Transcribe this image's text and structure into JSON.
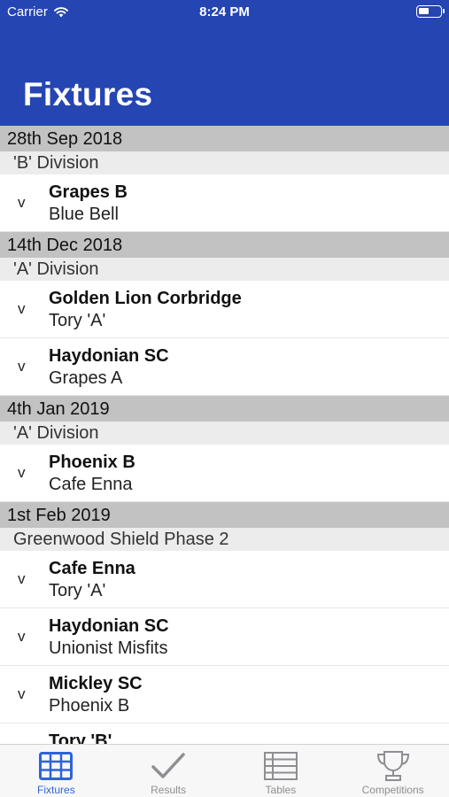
{
  "status": {
    "carrier": "Carrier",
    "time": "8:24 PM",
    "wifi_icon": "wifi-icon",
    "battery_icon": "battery-icon"
  },
  "header": {
    "title": "Fixtures",
    "background": "#2545b2"
  },
  "fixtures": {
    "vs_text": "v",
    "groups": [
      {
        "date": "28th Sep 2018",
        "division": "'B' Division",
        "matches": [
          {
            "home": "Grapes B",
            "away": "Blue Bell"
          }
        ]
      },
      {
        "date": "14th Dec 2018",
        "division": "'A' Division",
        "matches": [
          {
            "home": "Golden Lion Corbridge",
            "away": "Tory 'A'"
          },
          {
            "home": "Haydonian SC",
            "away": "Grapes A"
          }
        ]
      },
      {
        "date": "4th Jan 2019",
        "division": "'A' Division",
        "matches": [
          {
            "home": "Phoenix B",
            "away": "Cafe Enna"
          }
        ]
      },
      {
        "date": "1st Feb 2019",
        "division": "Greenwood Shield Phase 2",
        "matches": [
          {
            "home": "Cafe Enna",
            "away": "Tory 'A'"
          },
          {
            "home": "Haydonian SC",
            "away": "Unionist Misfits"
          },
          {
            "home": "Mickley SC",
            "away": "Phoenix B"
          },
          {
            "home": "Tory 'B'",
            "away": ""
          }
        ]
      }
    ]
  },
  "tabbar": {
    "active_color": "#2f63d8",
    "inactive_color": "#8e8e93",
    "tabs": [
      {
        "label": "Fixtures",
        "icon": "grid-icon",
        "active": true
      },
      {
        "label": "Results",
        "icon": "checkmark-icon",
        "active": false
      },
      {
        "label": "Tables",
        "icon": "table-icon",
        "active": false
      },
      {
        "label": "Competitions",
        "icon": "trophy-icon",
        "active": false
      }
    ]
  }
}
